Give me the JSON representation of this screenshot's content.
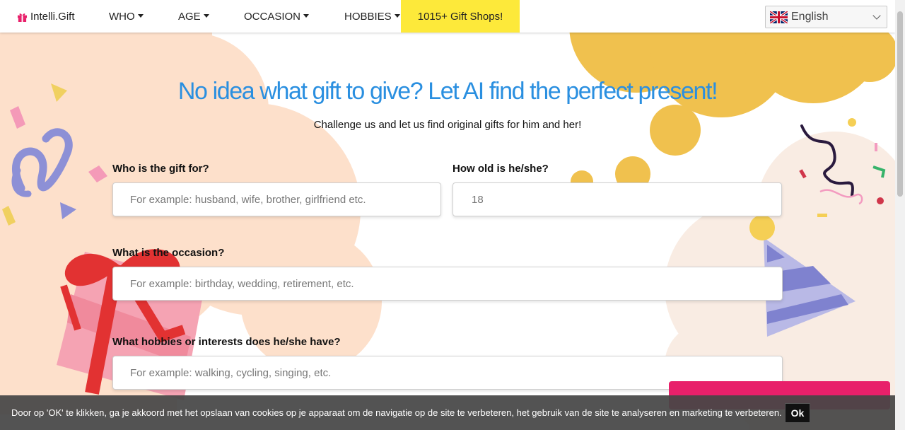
{
  "nav": {
    "brand": "Intelli.Gift",
    "who": "WHO",
    "age": "AGE",
    "occasion": "OCCASION",
    "hobbies": "HOBBIES",
    "shops": "1015+ Gift Shops!",
    "language": "English"
  },
  "hero": {
    "headline": "No idea what gift to give? Let AI find the perfect present!",
    "subtitle": "Challenge us and let us find original gifts for him and her!"
  },
  "form": {
    "who_label": "Who is the gift for?",
    "who_placeholder": "For example: husband, wife, brother, girlfriend etc.",
    "age_label": "How old is he/she?",
    "age_placeholder": "18",
    "occasion_label": "What is the occasion?",
    "occasion_placeholder": "For example: birthday, wedding, retirement, etc.",
    "hobbies_label": "What hobbies or interests does he/she have?",
    "hobbies_placeholder": "For example: walking, cycling, singing, etc."
  },
  "cookie": {
    "text": "Door op 'OK' te klikken, ga je akkoord met het opslaan van cookies op je apparaat om de navigatie op de site te verbeteren, het gebruik van de site te analyseren en marketing te verbeteren.",
    "ok": "Ok"
  },
  "colors": {
    "headline": "#2a8fe0",
    "shops_bg": "#fde93a",
    "promo": "#e8206a",
    "cookie_bg": "#464646"
  },
  "icons": [
    "gift-icon",
    "caret-down-icon",
    "uk-flag-icon",
    "chevron-down-icon"
  ]
}
